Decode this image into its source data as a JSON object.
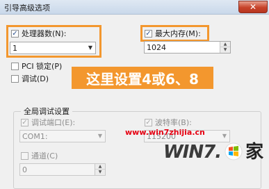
{
  "window": {
    "title": "引导高级选项",
    "close_glyph": "✕"
  },
  "processors": {
    "label": "处理器数(N):",
    "checked": true,
    "value": "1"
  },
  "max_memory": {
    "label": "最大内存(M):",
    "checked": true,
    "value": "1024"
  },
  "pci_lock": {
    "label": "PCI 锁定(P)",
    "checked": false
  },
  "debug": {
    "label": "调试(D)",
    "checked": false
  },
  "annotation": {
    "text": "这里设置4或6、8",
    "color": "#f3972e"
  },
  "global_debug": {
    "title": "全局调试设置",
    "debug_port_label": "调试端口(E):",
    "debug_port_value": "COM1:",
    "baud_label": "波特率(B):",
    "baud_checked": true,
    "baud_value": "115200",
    "channel_label": "通道(C)",
    "channel_value": "0"
  },
  "watermark": {
    "url": "www.win7zhijia.cn",
    "logo_text": "WIN7.",
    "logo_char": "家",
    "color": "#e60012"
  }
}
